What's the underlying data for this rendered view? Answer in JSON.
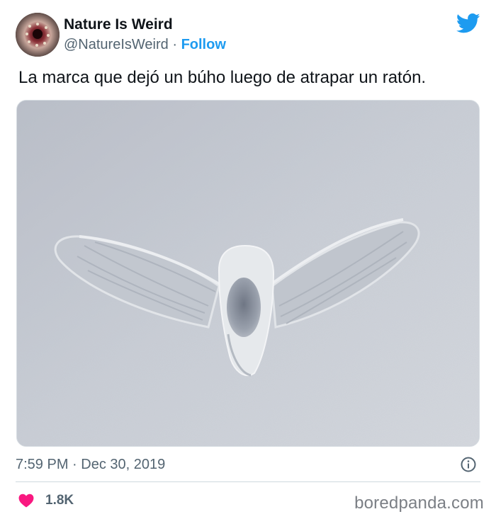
{
  "tweet": {
    "author": {
      "display_name": "Nature Is Weird",
      "handle": "@NatureIsWeird",
      "separator": "·",
      "follow_label": "Follow",
      "avatar_icon": "lamprey-mouth-avatar"
    },
    "platform_icon": "twitter-bird-icon",
    "text": "La marca que dejó un búho luego de atrapar un ratón.",
    "media": {
      "image_icon": "owl-wing-imprint-in-snow-photo"
    },
    "timestamp": "7:59 PM · Dec 30, 2019",
    "info_icon": "info-icon",
    "likes": {
      "icon": "heart-icon",
      "count": "1.8K"
    }
  },
  "watermark": "boredpanda.com",
  "colors": {
    "accent": "#1d9bf0",
    "heart": "#f91880",
    "secondary_text": "#536471",
    "primary_text": "#0f1419"
  }
}
